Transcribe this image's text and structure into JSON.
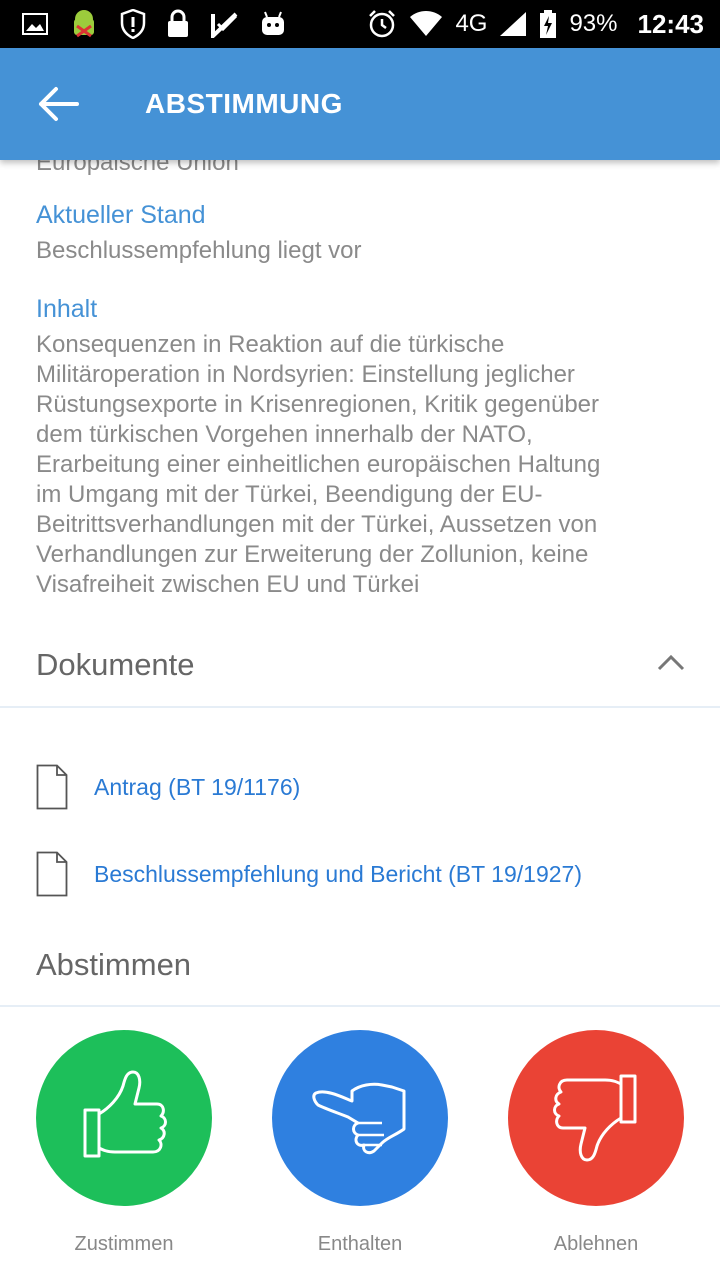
{
  "status_bar": {
    "network": "4G",
    "battery": "93%",
    "time": "12:43"
  },
  "app_bar": {
    "title": "ABSTIMMUNG"
  },
  "details": {
    "cut_text": "Europäische Union",
    "stand_label": "Aktueller Stand",
    "stand_value": "Beschlussempfehlung liegt vor",
    "inhalt_label": "Inhalt",
    "inhalt_lines": [
      "Konsequenzen in Reaktion auf die türkische",
      "Militäroperation in Nordsyrien: Einstellung jeglicher",
      "Rüstungsexporte in Krisenregionen, Kritik gegenüber",
      "dem türkischen Vorgehen innerhalb der NATO,",
      "Erarbeitung einer einheitlichen europäischen Haltung",
      "im Umgang mit der Türkei, Beendigung der EU-",
      "Beitrittsverhandlungen mit der Türkei, Aussetzen von",
      "Verhandlungen zur Erweiterung der Zollunion, keine",
      "Visafreiheit zwischen EU und Türkei"
    ]
  },
  "documents": {
    "title": "Dokumente",
    "items": [
      "Antrag (BT 19/1176)",
      "Beschlussempfehlung und Bericht (BT 19/1927)"
    ]
  },
  "vote": {
    "title": "Abstimmen",
    "options": [
      {
        "label": "Zustimmen",
        "color": "#1dbf5a",
        "icon": "thumbs-up-icon"
      },
      {
        "label": "Enthalten",
        "color": "#2f80e0",
        "icon": "thumb-sideways-icon"
      },
      {
        "label": "Ablehnen",
        "color": "#ea4335",
        "icon": "thumbs-down-icon"
      }
    ]
  }
}
